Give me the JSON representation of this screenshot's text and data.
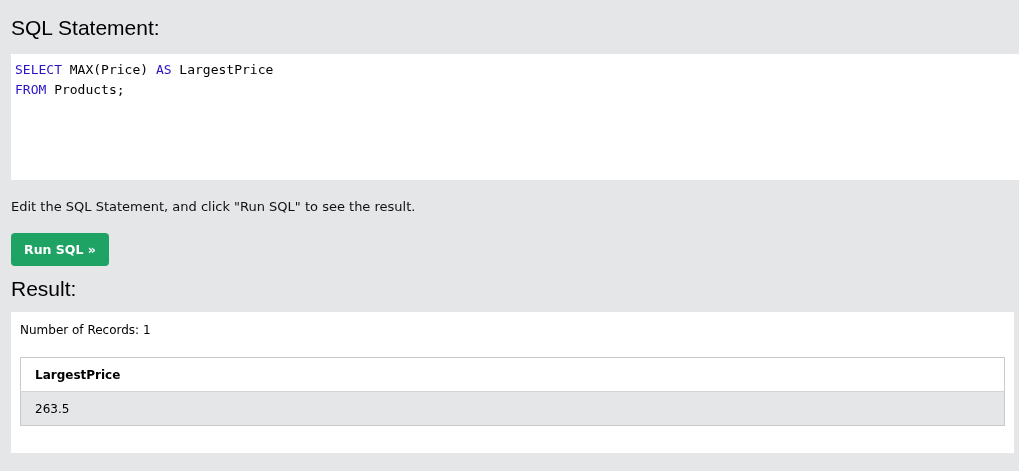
{
  "sql_heading": "SQL Statement:",
  "editor": {
    "lines": [
      [
        {
          "kind": "keyword",
          "text": "SELECT"
        },
        {
          "kind": "plain",
          "text": " MAX(Price) "
        },
        {
          "kind": "keyword",
          "text": "AS"
        },
        {
          "kind": "plain",
          "text": " LargestPrice"
        }
      ],
      [
        {
          "kind": "keyword",
          "text": "FROM"
        },
        {
          "kind": "plain",
          "text": " Products;"
        }
      ]
    ]
  },
  "instructions": "Edit the SQL Statement, and click \"Run SQL\" to see the result.",
  "run_button": "Run SQL »",
  "result_heading": "Result:",
  "result": {
    "record_count": "Number of Records: 1",
    "table": {
      "columns": [
        "LargestPrice"
      ],
      "rows": [
        [
          "263.5"
        ]
      ]
    }
  }
}
